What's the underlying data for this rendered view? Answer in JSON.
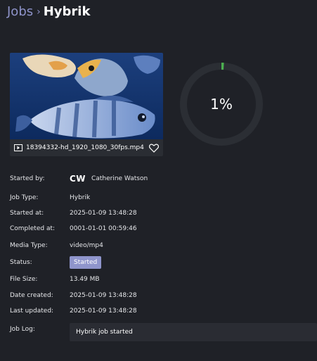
{
  "breadcrumb": {
    "parent": "Jobs",
    "separator": "›",
    "current": "Hybrik"
  },
  "media": {
    "file_name": "18394332-hd_1920_1080_30fps.mp4",
    "icon": "video-icon",
    "favorite_icon": "heart-icon"
  },
  "progress": {
    "percent": 0.01,
    "label": "1%",
    "color": "#4caf50",
    "track_color": "#2b2e34"
  },
  "details": {
    "started_by": {
      "label": "Started by:",
      "initials": "CW",
      "name": "Catherine Watson"
    },
    "job_type": {
      "label": "Job Type:",
      "value": "Hybrik"
    },
    "started_at": {
      "label": "Started at:",
      "value": "2025-01-09 13:48:28"
    },
    "completed_at": {
      "label": "Completed at:",
      "value": "0001-01-01 00:59:46"
    },
    "media_type": {
      "label": "Media Type:",
      "value": "video/mp4"
    },
    "status": {
      "label": "Status:",
      "value": "Started",
      "color": "#8f95cc"
    },
    "file_size": {
      "label": "File Size:",
      "value": "13.49 MB"
    },
    "date_created": {
      "label": "Date created:",
      "value": "2025-01-09 13:48:28"
    },
    "last_updated": {
      "label": "Last updated:",
      "value": "2025-01-09 13:48:28"
    },
    "job_log": {
      "label": "Job Log:",
      "value": "Hybrik job started"
    }
  }
}
